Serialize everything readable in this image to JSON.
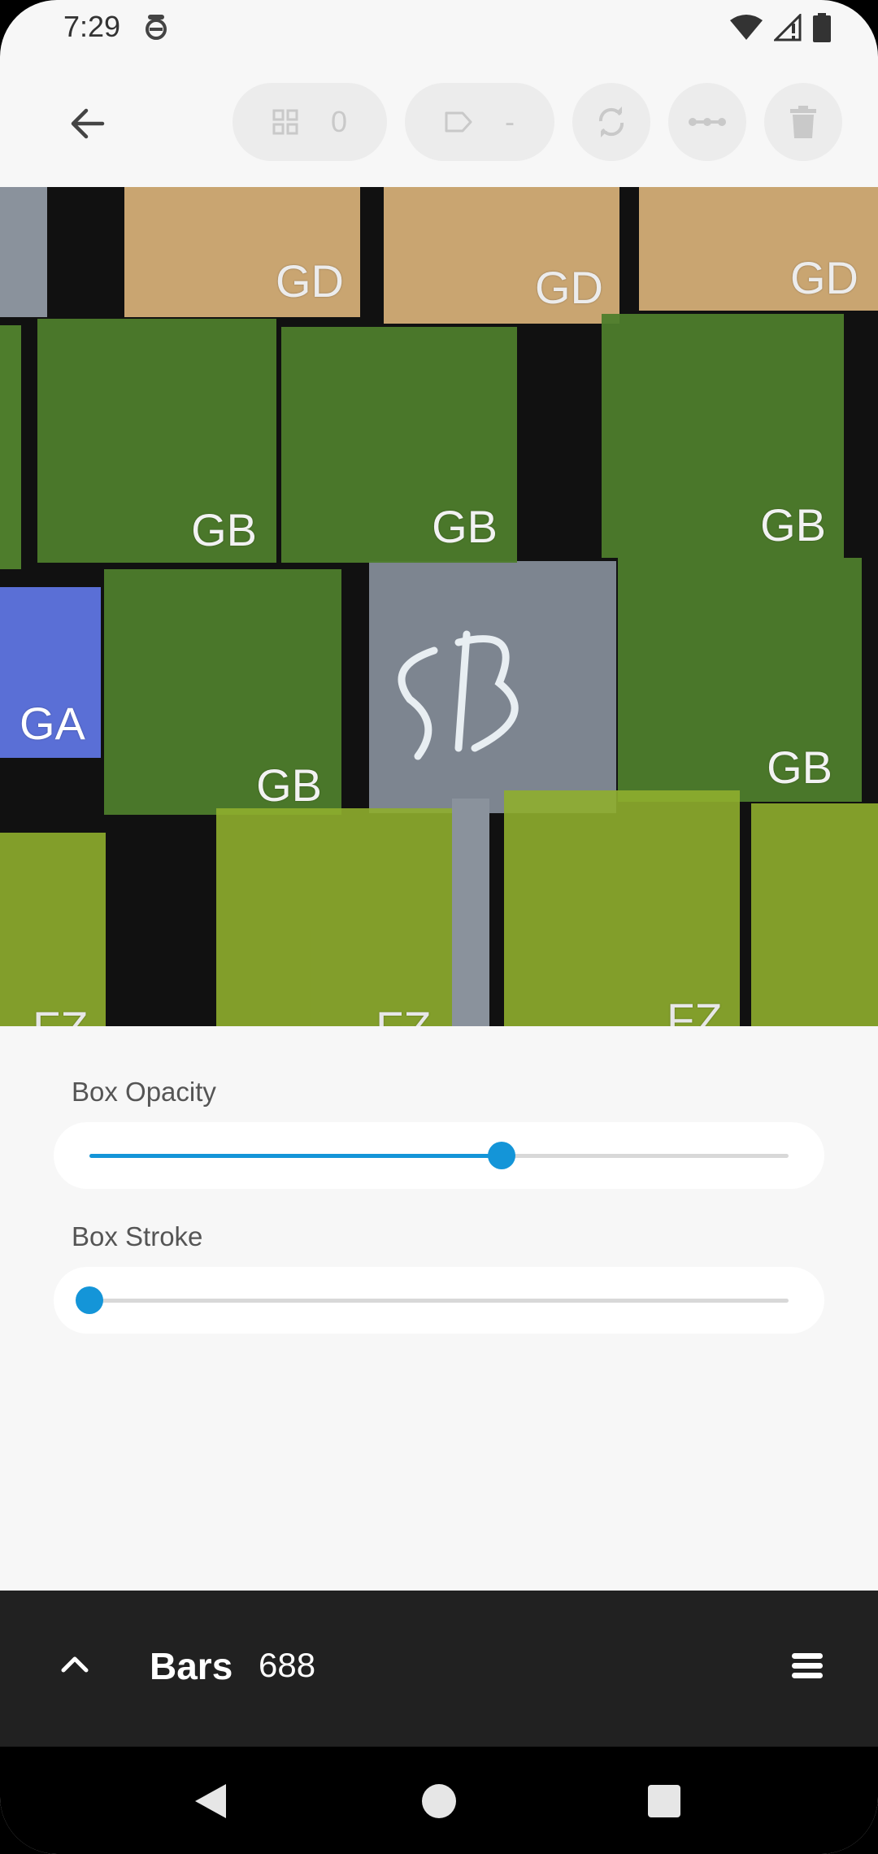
{
  "status_bar": {
    "time": "7:29",
    "icons": [
      "notification-icon",
      "wifi-icon",
      "cell-signal-icon",
      "battery-icon"
    ]
  },
  "toolbar": {
    "back_icon": "arrow-back-icon",
    "grid_count": "0",
    "tag_value": "-",
    "actions": [
      "sync-icon",
      "more-horizontal-icon",
      "delete-icon"
    ]
  },
  "detections": [
    {
      "label": "GD"
    },
    {
      "label": "GD"
    },
    {
      "label": "GD"
    },
    {
      "label": "GB"
    },
    {
      "label": "GB"
    },
    {
      "label": "GB"
    },
    {
      "label": "GA"
    },
    {
      "label": "GB"
    },
    {
      "label": "GB"
    },
    {
      "label": "FZ"
    },
    {
      "label": "FZ"
    },
    {
      "label": "FZ"
    }
  ],
  "class_colors": {
    "GD": "#d9b27a",
    "GB": "#4e7d2c",
    "GA": "#5a6fd6",
    "FZ": "#8fae2e"
  },
  "sliders": {
    "box_opacity_label": "Box Opacity",
    "box_opacity_value": 0.59,
    "box_stroke_label": "Box Stroke",
    "box_stroke_value": 0.0
  },
  "bottom_bar": {
    "title": "Bars",
    "count": "688"
  },
  "accent_color": "#1495d8"
}
